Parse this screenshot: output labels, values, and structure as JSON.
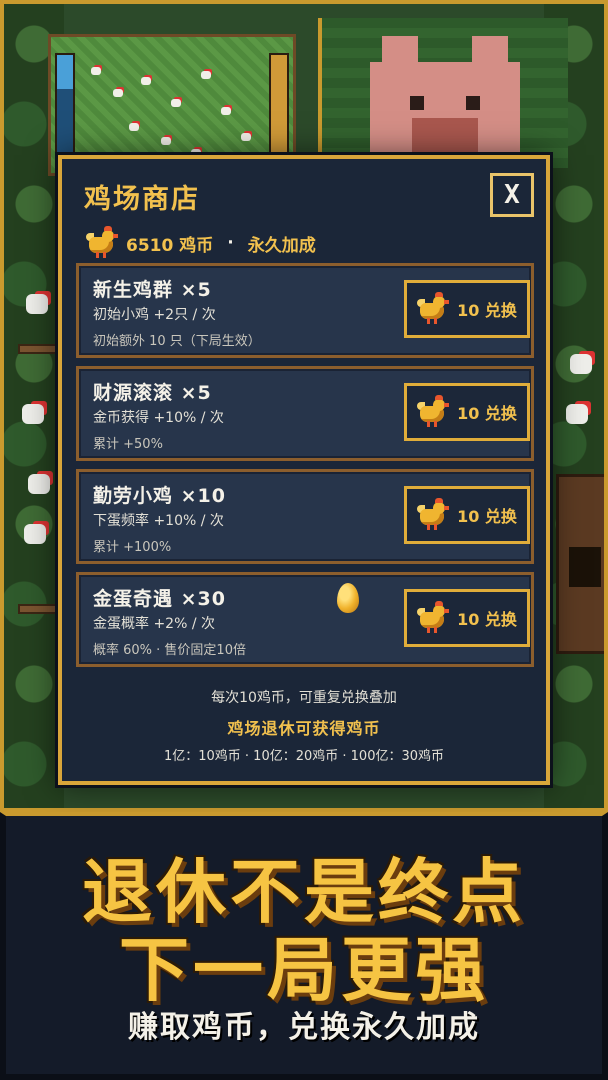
{
  "shop": {
    "title": "鸡场商店",
    "close_label": "X",
    "coins": "6510 鸡币",
    "separator": "·",
    "coins_note": "永久加成"
  },
  "items": [
    {
      "name": "新生鸡群 ×5",
      "effect": "初始小鸡 +2只 / 次",
      "total": "初始额外 10 只（下局生效）",
      "buy_label": "10 兑换"
    },
    {
      "name": "财源滚滚 ×5",
      "effect": "金币获得 +10% / 次",
      "total": "累计 +50%",
      "buy_label": "10 兑换"
    },
    {
      "name": "勤劳小鸡 ×10",
      "effect": "下蛋频率 +10% / 次",
      "total": "累计 +100%",
      "buy_label": "10 兑换"
    },
    {
      "name": "金蛋奇遇 ×30",
      "effect": "金蛋概率 +2% / 次",
      "total": "概率 60% · 售价固定10倍",
      "buy_label": "10 兑换"
    }
  ],
  "footer": {
    "note1": "每次10鸡币，可重复兑换叠加",
    "note2": "鸡场退休可获得鸡币",
    "note3": "1亿：10鸡币 · 10亿：20鸡币 · 100亿：30鸡币"
  },
  "banner": {
    "line1": "退休不是终点",
    "line2": "下一局更强",
    "line3": "赚取鸡币，兑换永久加成"
  },
  "icons": {
    "coin": "chicken-coin-icon",
    "egg": "golden-egg-icon",
    "close": "close-icon"
  },
  "colors": {
    "accent_gold": "#f2c14e",
    "panel_bg": "#1b2638",
    "item_border": "#8c5e2d"
  }
}
